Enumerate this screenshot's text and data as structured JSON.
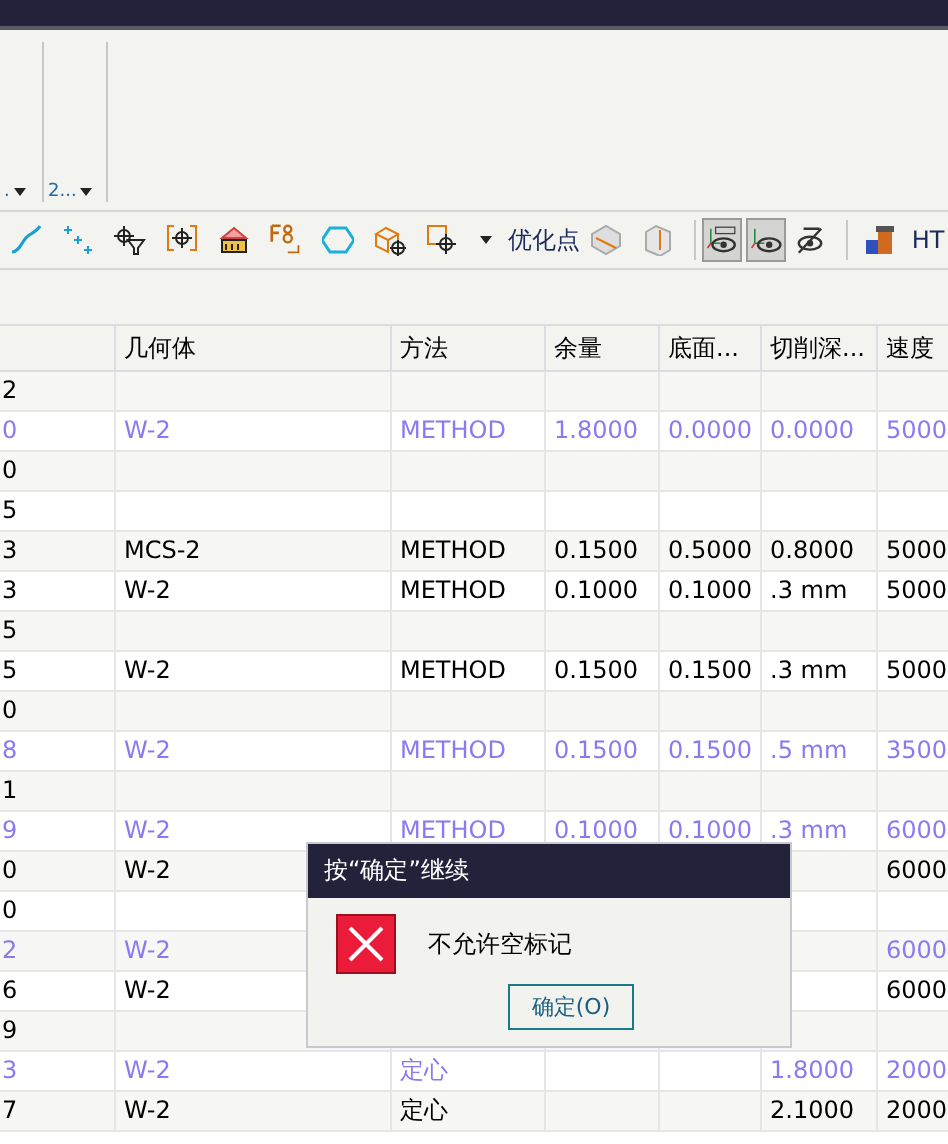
{
  "ribbon_groups": [
    {
      "label": "."
    },
    {
      "label": "2..."
    }
  ],
  "toolbar": {
    "text_button": "优化点",
    "toggles": [
      {
        "kind": "mcs-eye",
        "selected": true
      },
      {
        "kind": "eye",
        "selected": true
      },
      {
        "kind": "eye-off",
        "selected": false
      }
    ],
    "cut_label": "HT"
  },
  "table": {
    "columns": [
      "",
      "几何体",
      "方法",
      "余量",
      "底面...",
      "切削深...",
      "速度"
    ],
    "rows": [
      {
        "cells": [
          "2",
          "",
          "",
          "",
          "",
          "",
          ""
        ],
        "color": "#000000"
      },
      {
        "cells": [
          "0",
          "W-2",
          "METHOD",
          "1.8000",
          "0.0000",
          "0.0000",
          "5000"
        ],
        "color": "#8d78f0"
      },
      {
        "cells": [
          "0",
          "",
          "",
          "",
          "",
          "",
          ""
        ],
        "color": "#000000"
      },
      {
        "cells": [
          "5",
          "",
          "",
          "",
          "",
          "",
          ""
        ],
        "color": "#000000"
      },
      {
        "cells": [
          "3",
          "MCS-2",
          "METHOD",
          "0.1500",
          "0.5000",
          "0.8000",
          "5000"
        ],
        "color": "#000000"
      },
      {
        "cells": [
          "3",
          "W-2",
          "METHOD",
          "0.1000",
          "0.1000",
          ".3 mm",
          "5000"
        ],
        "color": "#000000"
      },
      {
        "cells": [
          "5",
          "",
          "",
          "",
          "",
          "",
          ""
        ],
        "color": "#000000"
      },
      {
        "cells": [
          "5",
          "W-2",
          "METHOD",
          "0.1500",
          "0.1500",
          ".3 mm",
          "5000"
        ],
        "color": "#000000"
      },
      {
        "cells": [
          "0",
          "",
          "",
          "",
          "",
          "",
          ""
        ],
        "color": "#000000"
      },
      {
        "cells": [
          "8",
          "W-2",
          "METHOD",
          "0.1500",
          "0.1500",
          ".5 mm",
          "3500"
        ],
        "color": "#8d78f0"
      },
      {
        "cells": [
          "1",
          "",
          "",
          "",
          "",
          "",
          ""
        ],
        "color": "#000000"
      },
      {
        "cells": [
          "9",
          "W-2",
          "METHOD",
          "0.1000",
          "0.1000",
          ".3 mm",
          "6000"
        ],
        "color": "#8d78f0"
      },
      {
        "cells": [
          "0",
          "W-2",
          "",
          "",
          "",
          "",
          "6000"
        ],
        "color": "#000000"
      },
      {
        "cells": [
          "0",
          "",
          "",
          "",
          "",
          "",
          ""
        ],
        "color": "#000000"
      },
      {
        "cells": [
          "2",
          "W-2",
          "",
          "",
          "",
          "",
          "6000"
        ],
        "color": "#8d78f0"
      },
      {
        "cells": [
          "6",
          "W-2",
          "",
          "",
          "",
          "",
          "6000"
        ],
        "color": "#000000"
      },
      {
        "cells": [
          "9",
          "",
          "",
          "",
          "",
          "",
          ""
        ],
        "color": "#000000"
      },
      {
        "cells": [
          "3",
          "W-2",
          "定心",
          "",
          "",
          "1.8000",
          "2000"
        ],
        "color": "#8d78f0"
      },
      {
        "cells": [
          "7",
          "W-2",
          "定心",
          "",
          "",
          "2.1000",
          "2000"
        ],
        "color": "#000000"
      }
    ]
  },
  "dialog": {
    "title": "按“确定”继续",
    "message": "不允许空标记",
    "button": "确定(O)"
  }
}
